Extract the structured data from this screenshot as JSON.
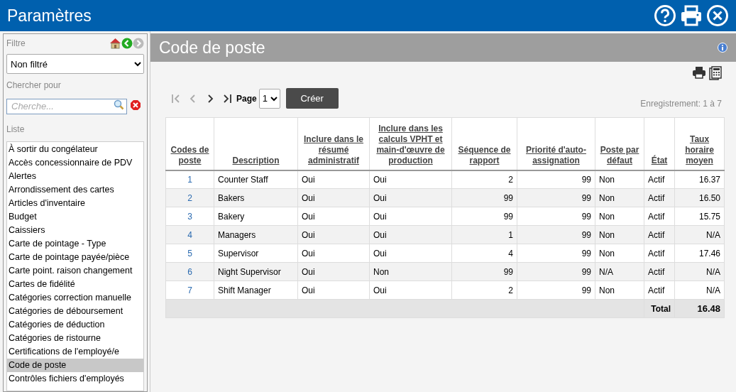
{
  "window": {
    "title": "Paramètres"
  },
  "sidebar": {
    "filter_label": "Filtre",
    "filter_value": "Non filtré",
    "search_label": "Chercher pour",
    "search": {
      "placeholder": "Cherche..."
    },
    "list_label": "Liste",
    "items": [
      {
        "label": "À sortir du congélateur",
        "selected": false
      },
      {
        "label": "Accès concessionnaire de PDV",
        "selected": false
      },
      {
        "label": "Alertes",
        "selected": false
      },
      {
        "label": "Arrondissement des cartes",
        "selected": false
      },
      {
        "label": "Articles d'inventaire",
        "selected": false
      },
      {
        "label": "Budget",
        "selected": false
      },
      {
        "label": "Caissiers",
        "selected": false
      },
      {
        "label": "Carte de pointage - Type",
        "selected": false
      },
      {
        "label": "Carte de pointage payée/pièce",
        "selected": false
      },
      {
        "label": "Carte point. raison changement",
        "selected": false
      },
      {
        "label": "Cartes de fidélité",
        "selected": false
      },
      {
        "label": "Catégories correction manuelle",
        "selected": false
      },
      {
        "label": "Catégories de déboursement",
        "selected": false
      },
      {
        "label": "Catégories de déduction",
        "selected": false
      },
      {
        "label": "Catégories de ristourne",
        "selected": false
      },
      {
        "label": "Certifications de l'employé/e",
        "selected": false
      },
      {
        "label": "Code de poste",
        "selected": true
      },
      {
        "label": "Contrôles fichiers d'employés",
        "selected": false
      }
    ]
  },
  "main": {
    "title": "Code de poste",
    "page_label": "Page",
    "page_value": "1",
    "create_button": "Créer",
    "records": "Enregistrement: 1 à 7",
    "table": {
      "columns": [
        "Codes de poste",
        "Description",
        "Inclure dans le résumé administratif",
        "Inclure dans les calculs VPHT et main-d'œuvre de production",
        "Séquence de rapport",
        "Priorité d'auto-assignation",
        "Poste par défaut",
        "État",
        "Taux horaire moyen"
      ],
      "rows": [
        [
          "1",
          "Counter Staff",
          "Oui",
          "Oui",
          "2",
          "99",
          "Non",
          "Actif",
          "16.37"
        ],
        [
          "2",
          "Bakers",
          "Oui",
          "Oui",
          "99",
          "99",
          "Non",
          "Actif",
          "16.50"
        ],
        [
          "3",
          "Bakery",
          "Oui",
          "Oui",
          "99",
          "99",
          "Non",
          "Actif",
          "15.75"
        ],
        [
          "4",
          "Managers",
          "Oui",
          "Oui",
          "1",
          "99",
          "Non",
          "Actif",
          "N/A"
        ],
        [
          "5",
          "Supervisor",
          "Oui",
          "Oui",
          "4",
          "99",
          "Non",
          "Actif",
          "17.46"
        ],
        [
          "6",
          "Night Supervisor",
          "Oui",
          "Non",
          "99",
          "99",
          "N/A",
          "Actif",
          "N/A"
        ],
        [
          "7",
          "Shift Manager",
          "Oui",
          "Oui",
          "2",
          "99",
          "Non",
          "Actif",
          "N/A"
        ]
      ],
      "total_label": "Total",
      "total_value": "16.48"
    }
  }
}
